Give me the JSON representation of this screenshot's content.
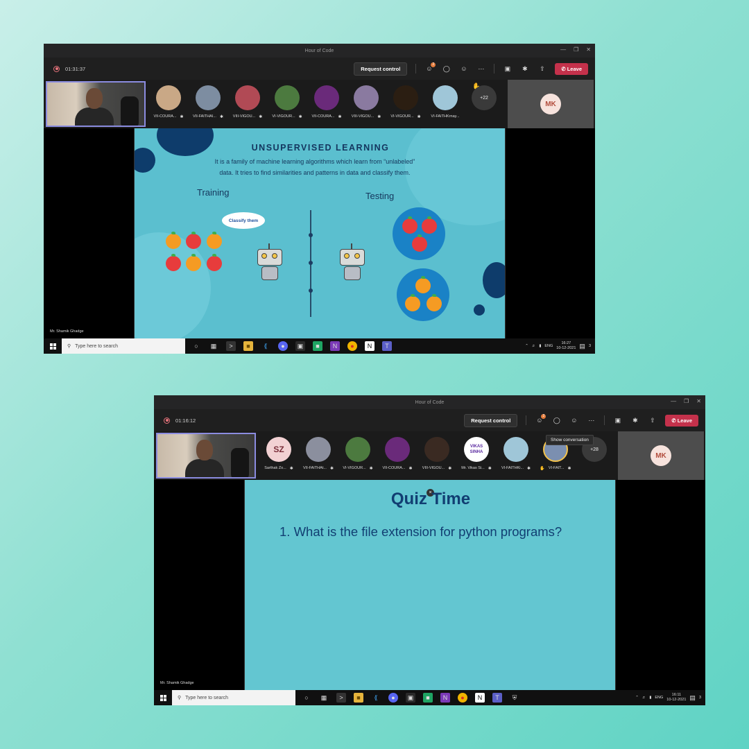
{
  "accent": "#5fd3c4",
  "windows": [
    {
      "title": "Hour of Code",
      "timer": "01:31:37",
      "request_control": "Request control",
      "leave": "Leave",
      "people_badge": "2",
      "participants": [
        {
          "name": "VII-COURA...",
          "color": "#c9a886"
        },
        {
          "name": "VII-FAITHAI...",
          "color": "#7d8da1"
        },
        {
          "name": "VIII-VIGOU...",
          "color": "#b14a55"
        },
        {
          "name": "VI-VIGOUR...",
          "color": "#4c7a3f"
        },
        {
          "name": "VII-COURA...",
          "color": "#6a2a7a"
        },
        {
          "name": "VIII-VIGOU...",
          "color": "#8a7aa0"
        },
        {
          "name": "VI-VIGOUR...",
          "color": "#2b1e12"
        },
        {
          "name": "VI-FAITHKrnay...",
          "color": "#9fc6d8"
        }
      ],
      "more_count": "+22",
      "mk": "MK",
      "presenter": "Mr. Shamik Ghadge",
      "search_placeholder": "Type here to search",
      "lang": "ENG",
      "time": "16:27",
      "date": "10-12-2021",
      "notif_count": "3",
      "slide": {
        "title": "UNSUPERVISED LEARNING",
        "desc": "It is a family of machine learning algorithms which learn from “unlabeled” data. It tries to find similarities and patterns in data and classify them.",
        "training": "Training",
        "testing": "Testing",
        "bubble": "Classify them"
      }
    },
    {
      "title": "Hour of Code",
      "timer": "01:16:12",
      "request_control": "Request control",
      "leave": "Leave",
      "people_badge": "2",
      "tooltip": "Show conversation",
      "participants": [
        {
          "name": "Sarthak Zo...",
          "initials": "SZ"
        },
        {
          "name": "VII-FAITHAt...",
          "color": "#8b8f9e"
        },
        {
          "name": "VI-VIGOUR...",
          "color": "#4c7a3f"
        },
        {
          "name": "VII-COURA...",
          "color": "#6a2a7a"
        },
        {
          "name": "VIII-VIGOU...",
          "color": "#3a2a22"
        },
        {
          "name": "Mr. Vikas Si...",
          "initials": "VIKAS SINHA"
        },
        {
          "name": "VI-FAITHKi...",
          "color": "#9fc6d8"
        },
        {
          "name": "VI-FAIT...",
          "color": "#7b8fb0"
        }
      ],
      "more_count": "+28",
      "mk": "MK",
      "presenter": "Mr. Shamik Ghadge",
      "search_placeholder": "Type here to search",
      "lang": "ENG",
      "time": "16:11",
      "date": "10-12-2021",
      "notif_count": "3",
      "slide": {
        "title": "Quiz Time",
        "question": "1. What is the file extension for python programs?"
      }
    }
  ],
  "icons": {
    "windows": "windows-logo-icon",
    "search": "search-icon",
    "people": "people-icon",
    "chat": "chat-icon",
    "reactions": "reactions-icon",
    "more": "more-icon",
    "camera": "camera-off-icon",
    "mic": "mic-off-icon",
    "share": "share-icon",
    "phone": "phone-icon"
  }
}
